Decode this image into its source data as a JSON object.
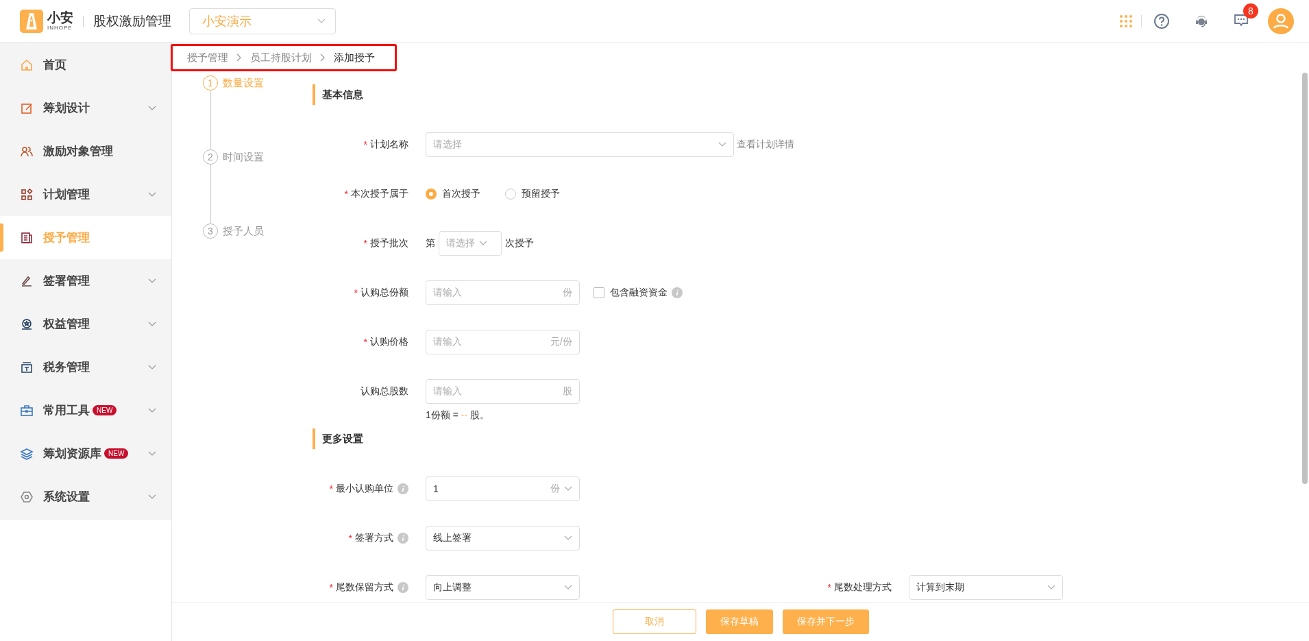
{
  "header": {
    "logo": {
      "name": "小安",
      "sub": "INHOPE"
    },
    "app_title": "股权激励管理",
    "company_select": {
      "value": "小安演示"
    },
    "message_badge": "8"
  },
  "sidebar": {
    "items": [
      {
        "label": "首页",
        "expandable": false,
        "selected": false
      },
      {
        "label": "筹划设计",
        "expandable": true,
        "selected": false
      },
      {
        "label": "激励对象管理",
        "expandable": false,
        "selected": false
      },
      {
        "label": "计划管理",
        "expandable": true,
        "selected": false
      },
      {
        "label": "授予管理",
        "expandable": false,
        "selected": true
      },
      {
        "label": "签署管理",
        "expandable": true,
        "selected": false
      },
      {
        "label": "权益管理",
        "expandable": true,
        "selected": false
      },
      {
        "label": "税务管理",
        "expandable": true,
        "selected": false
      },
      {
        "label": "常用工具",
        "expandable": true,
        "selected": false,
        "badge": "NEW"
      },
      {
        "label": "筹划资源库",
        "expandable": true,
        "selected": false,
        "badge": "NEW"
      },
      {
        "label": "系统设置",
        "expandable": true,
        "selected": false
      }
    ]
  },
  "breadcrumb": [
    "授予管理",
    "员工持股计划",
    "添加授予"
  ],
  "steps": [
    {
      "number": "1",
      "label": "数量设置",
      "selected": true
    },
    {
      "number": "2",
      "label": "时间设置",
      "selected": false
    },
    {
      "number": "3",
      "label": "授予人员",
      "selected": false
    }
  ],
  "sections": [
    {
      "title": "基本信息",
      "rows": [
        {
          "fields": [
            {
              "kind": "select",
              "required_mark": "*",
              "label": "计划名称",
              "info": false,
              "placeholder": "请选择",
              "wide": true,
              "link": "查看计划详情"
            }
          ]
        },
        {
          "fields": [
            {
              "kind": "radio",
              "required_mark": "*",
              "label": "本次授予属于",
              "info": false,
              "options": [
                {
                  "label": "首次授予",
                  "selected": true
                },
                {
                  "label": "预留授予",
                  "selected": false
                }
              ]
            }
          ]
        },
        {
          "fields": [
            {
              "kind": "batch",
              "required_mark": "*",
              "label": "授予批次",
              "info": false,
              "prefix": "第",
              "placeholder": "请选择",
              "suffix": "次授予"
            }
          ]
        },
        {
          "fields": [
            {
              "kind": "input",
              "required_mark": "*",
              "label": "认购总份额",
              "info": false,
              "placeholder": "请输入",
              "unit": "份",
              "checkbox": {
                "label": "包含融资资金",
                "checked": false
              }
            }
          ]
        },
        {
          "fields": [
            {
              "kind": "input",
              "required_mark": "*",
              "label": "认购价格",
              "info": false,
              "placeholder": "请输入",
              "unit": "元/份"
            }
          ]
        },
        {
          "fields": [
            {
              "kind": "input",
              "label": "认购总股数",
              "info": false,
              "placeholder": "请输入",
              "unit": "股",
              "note": {
                "before": "1份额 =",
                "value": "--",
                "after": "股。"
              }
            }
          ]
        }
      ]
    },
    {
      "title": "更多设置",
      "rows": [
        {
          "fields": [
            {
              "kind": "select",
              "required_mark": "*",
              "label": "最小认购单位",
              "info": true,
              "value": "1",
              "unit": "份"
            }
          ]
        },
        {
          "fields": [
            {
              "kind": "select",
              "required_mark": "*",
              "label": "签署方式",
              "info": true,
              "value": "线上签署"
            }
          ]
        },
        {
          "fields": [
            {
              "kind": "select",
              "required_mark": "*",
              "label": "尾数保留方式",
              "info": true,
              "value": "向上调整"
            },
            {
              "kind": "select",
              "required_mark": "*",
              "label": "尾数处理方式",
              "info": false,
              "value": "计算到末期"
            }
          ]
        }
      ]
    }
  ],
  "footer_buttons": [
    {
      "label": "取消",
      "kind": "outline"
    },
    {
      "label": "保存草稿",
      "kind": "primary"
    },
    {
      "label": "保存并下一步",
      "kind": "primary"
    }
  ]
}
